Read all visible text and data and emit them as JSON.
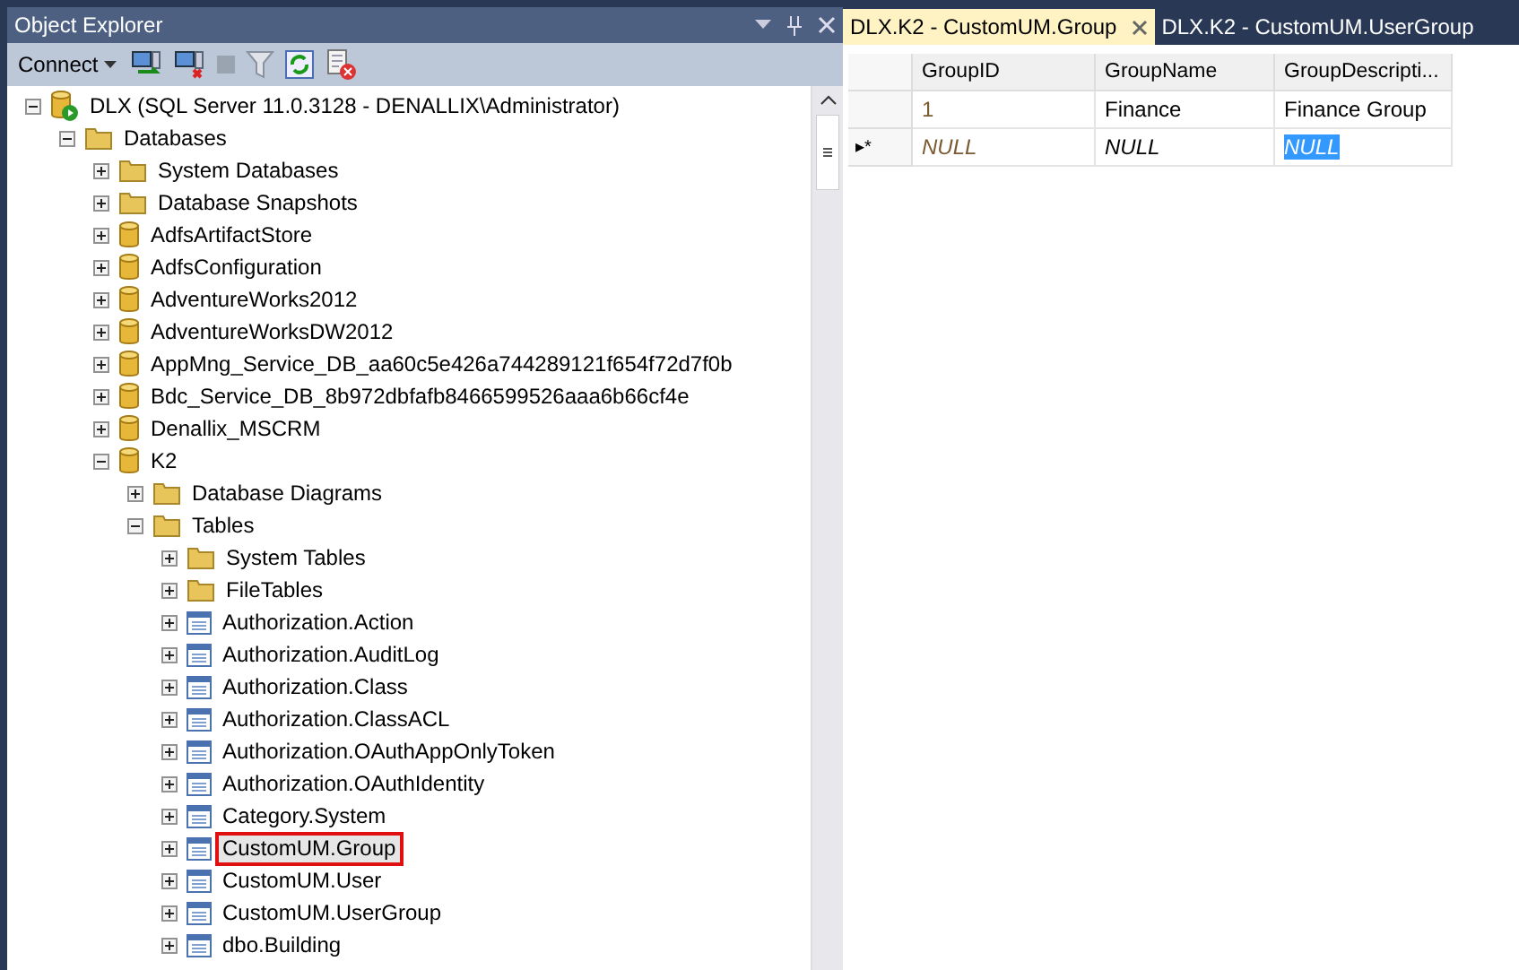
{
  "object_explorer": {
    "title": "Object Explorer",
    "toolbar": {
      "connect": "Connect"
    },
    "tree": [
      {
        "label": "DLX (SQL Server 11.0.3128 - DENALLIX\\Administrator)",
        "kind": "server",
        "expanded": true,
        "children": [
          {
            "label": "Databases",
            "kind": "folder",
            "expanded": true,
            "children": [
              {
                "label": "System Databases",
                "kind": "folder",
                "expanded": false
              },
              {
                "label": "Database Snapshots",
                "kind": "folder",
                "expanded": false
              },
              {
                "label": "AdfsArtifactStore",
                "kind": "database",
                "expanded": false
              },
              {
                "label": "AdfsConfiguration",
                "kind": "database",
                "expanded": false
              },
              {
                "label": "AdventureWorks2012",
                "kind": "database",
                "expanded": false
              },
              {
                "label": "AdventureWorksDW2012",
                "kind": "database",
                "expanded": false
              },
              {
                "label": "AppMng_Service_DB_aa60c5e426a744289121f654f72d7f0b",
                "kind": "database",
                "expanded": false
              },
              {
                "label": "Bdc_Service_DB_8b972dbfafb8466599526aaa6b66cf4e",
                "kind": "database",
                "expanded": false
              },
              {
                "label": "Denallix_MSCRM",
                "kind": "database",
                "expanded": false
              },
              {
                "label": "K2",
                "kind": "database",
                "expanded": true,
                "children": [
                  {
                    "label": "Database Diagrams",
                    "kind": "folder",
                    "expanded": false
                  },
                  {
                    "label": "Tables",
                    "kind": "folder",
                    "expanded": true,
                    "children": [
                      {
                        "label": "System Tables",
                        "kind": "folder",
                        "expanded": false
                      },
                      {
                        "label": "FileTables",
                        "kind": "folder",
                        "expanded": false
                      },
                      {
                        "label": "Authorization.Action",
                        "kind": "table",
                        "expanded": false
                      },
                      {
                        "label": "Authorization.AuditLog",
                        "kind": "table",
                        "expanded": false
                      },
                      {
                        "label": "Authorization.Class",
                        "kind": "table",
                        "expanded": false
                      },
                      {
                        "label": "Authorization.ClassACL",
                        "kind": "table",
                        "expanded": false
                      },
                      {
                        "label": "Authorization.OAuthAppOnlyToken",
                        "kind": "table",
                        "expanded": false
                      },
                      {
                        "label": "Authorization.OAuthIdentity",
                        "kind": "table",
                        "expanded": false
                      },
                      {
                        "label": "Category.System",
                        "kind": "table",
                        "expanded": false
                      },
                      {
                        "label": "CustomUM.Group",
                        "kind": "table",
                        "expanded": false,
                        "selected": true,
                        "annotated": true
                      },
                      {
                        "label": "CustomUM.User",
                        "kind": "table",
                        "expanded": false
                      },
                      {
                        "label": "CustomUM.UserGroup",
                        "kind": "table",
                        "expanded": false
                      },
                      {
                        "label": "dbo.Building",
                        "kind": "table",
                        "expanded": false
                      }
                    ]
                  }
                ]
              }
            ]
          }
        ]
      }
    ]
  },
  "tabs": [
    {
      "label": "DLX.K2 - CustomUM.Group",
      "selected": true
    },
    {
      "label": "DLX.K2 - CustomUM.UserGroup",
      "selected": false
    }
  ],
  "grid": {
    "columns": [
      "GroupID",
      "GroupName",
      "GroupDescripti..."
    ],
    "rows": [
      {
        "marker": "",
        "is_new": false,
        "cells": [
          {
            "text": "1",
            "selected": false
          },
          {
            "text": "Finance",
            "selected": false
          },
          {
            "text": "Finance Group",
            "selected": false
          }
        ]
      },
      {
        "marker": "▸*",
        "is_new": true,
        "cells": [
          {
            "text": "NULL",
            "selected": false
          },
          {
            "text": "NULL",
            "selected": false
          },
          {
            "text": "NULL",
            "selected": true
          }
        ]
      }
    ]
  }
}
